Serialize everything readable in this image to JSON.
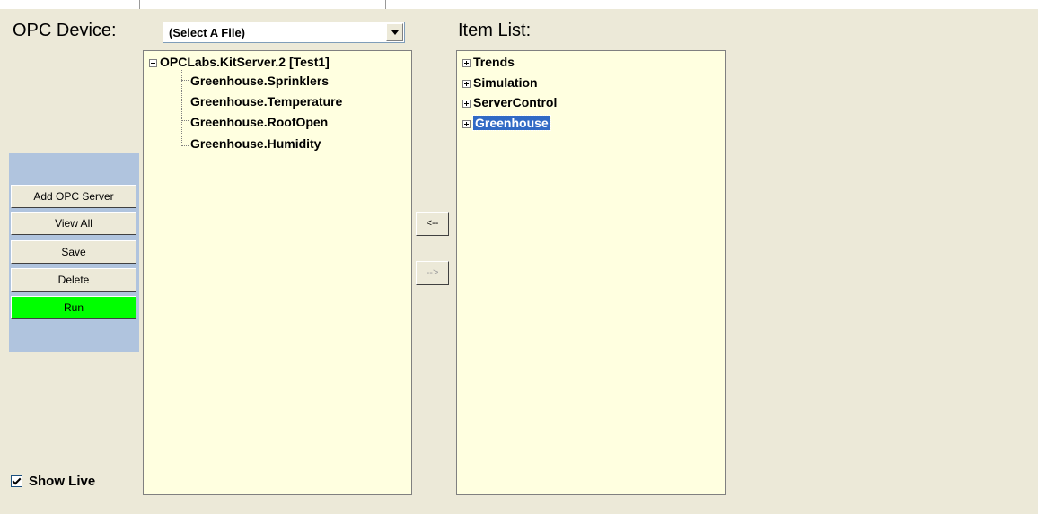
{
  "header": {
    "opc_device_label": "OPC Device:",
    "item_list_label": "Item List:"
  },
  "device_select": {
    "value": "(Select A File)"
  },
  "server_tree": {
    "root": "OPCLabs.KitServer.2 [Test1]",
    "items": [
      "Greenhouse.Sprinklers",
      "Greenhouse.Temperature",
      "Greenhouse.RoofOpen",
      "Greenhouse.Humidity"
    ]
  },
  "item_tree": {
    "items": [
      "Trends",
      "Simulation",
      "ServerControl",
      "Greenhouse"
    ],
    "selected": "Greenhouse"
  },
  "sidebar": {
    "add_server": "Add OPC Server",
    "view_all": "View All",
    "save": "Save",
    "delete": "Delete",
    "run": "Run",
    "run_color": "#00ff00"
  },
  "transfer": {
    "add": "<--",
    "remove": "-->"
  },
  "show_live": {
    "label": "Show Live",
    "checked": true
  }
}
